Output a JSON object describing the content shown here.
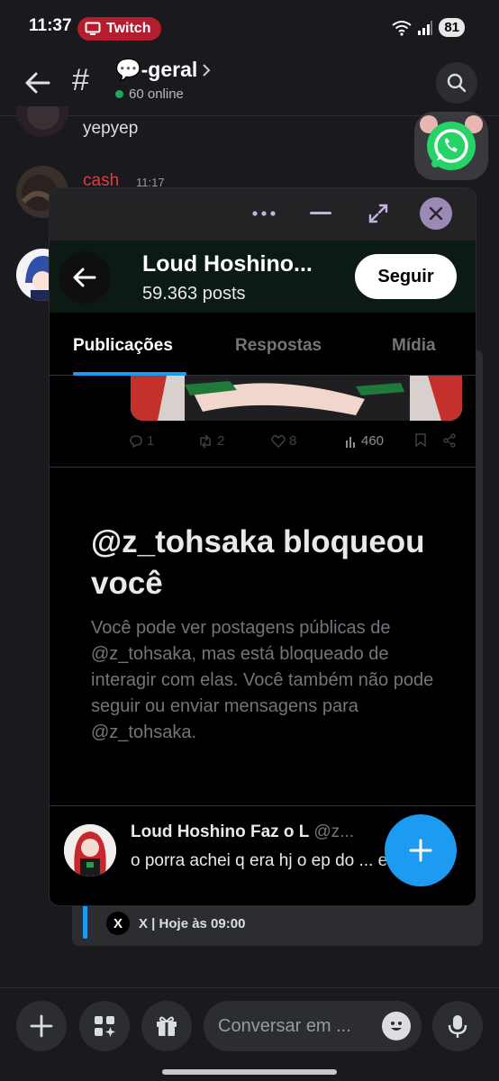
{
  "status_bar": {
    "time": "11:37",
    "pill_label": "Twitch",
    "battery": "81"
  },
  "channel": {
    "hash": "#",
    "name": "💬-geral",
    "online": "60 online"
  },
  "messages": [
    {
      "text": "yepyep"
    },
    {
      "author": "cash",
      "time": "11:17"
    }
  ],
  "embed": {
    "source": "X | Hoje às 09:00",
    "x_logo": "X"
  },
  "x_popup": {
    "profile_name": "Loud Hoshino...",
    "posts": "59.363 posts",
    "follow_label": "Seguir",
    "tabs": [
      {
        "label": "Publicações",
        "active": true
      },
      {
        "label": "Respostas",
        "active": false
      },
      {
        "label": "Mídia",
        "active": false
      }
    ],
    "actions": {
      "replies": "1",
      "reposts": "2",
      "likes": "8",
      "views": "460"
    },
    "blocked_title": "@z_tohsaka bloqueou você",
    "blocked_body": "Você pode ver postagens públicas de @z_tohsaka, mas está bloqueado de interagir com elas. Você também não pode seguir ou enviar mensagens para @z_tohsaka.",
    "tweet": {
      "name": "Loud Hoshino Faz o L",
      "handle": "@z...",
      "text": "o porra achei q era hj o ep do ... e tmnc"
    }
  },
  "composer": {
    "placeholder": "Conversar em ..."
  },
  "colors": {
    "accent": "#1d9bf0",
    "online": "#23a55a",
    "twitch": "#b31d2e",
    "whatsapp": "#25d366"
  }
}
